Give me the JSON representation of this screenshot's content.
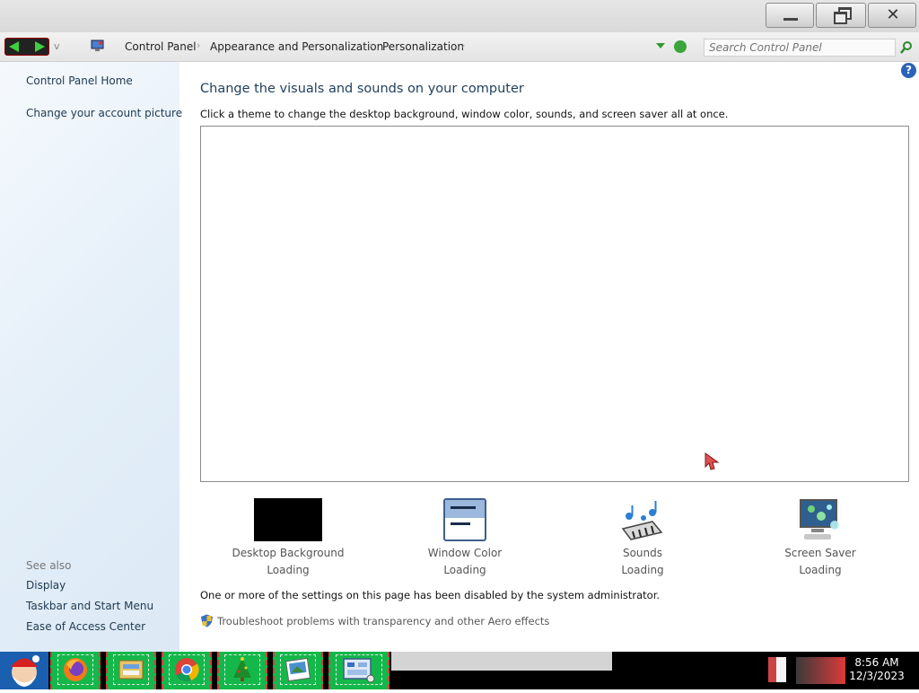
{
  "window": {
    "controls": {
      "minimize_icon": "minimize-icon",
      "maximize_icon": "restore-icon",
      "close_glyph": "✕"
    }
  },
  "address_bar": {
    "history_glyph": "v",
    "breadcrumbs": [
      "Control Panel",
      "Appearance and Personalization",
      "Personalization"
    ],
    "separator": "›",
    "search_placeholder": "Search Control Panel"
  },
  "left_pane": {
    "links": [
      "Control Panel Home",
      "Change your account picture"
    ],
    "see_also_label": "See also",
    "see_also_links": [
      "Display",
      "Taskbar and Start Menu",
      "Ease of Access Center"
    ]
  },
  "content": {
    "title": "Change the visuals and sounds on your computer",
    "description": "Click a theme to change the desktop background, window color, sounds, and screen saver all at once.",
    "settings": [
      {
        "label": "Desktop Background",
        "status": "Loading",
        "icon": "desktop-background-icon"
      },
      {
        "label": "Window Color",
        "status": "Loading",
        "icon": "window-color-icon"
      },
      {
        "label": "Sounds",
        "status": "Loading",
        "icon": "sounds-icon"
      },
      {
        "label": "Screen Saver",
        "status": "Loading",
        "icon": "screen-saver-icon"
      }
    ],
    "disabled_notice": "One or more of the settings on this page has been disabled by the system administrator.",
    "troubleshoot_link": "Troubleshoot problems with transparency and other Aero effects",
    "help_glyph": "?"
  },
  "taskbar": {
    "apps": [
      "firefox-icon",
      "file-explorer-icon",
      "chrome-icon",
      "christmas-tree-icon",
      "photos-icon",
      "control-panel-icon"
    ],
    "clock_time": "8:56 AM",
    "clock_date": "12/3/2023"
  },
  "colors": {
    "accent": "#1e3e5c",
    "left_pane": "#e3eef8",
    "taskbar": "#000000",
    "taskbar_button": "#14b84a"
  }
}
